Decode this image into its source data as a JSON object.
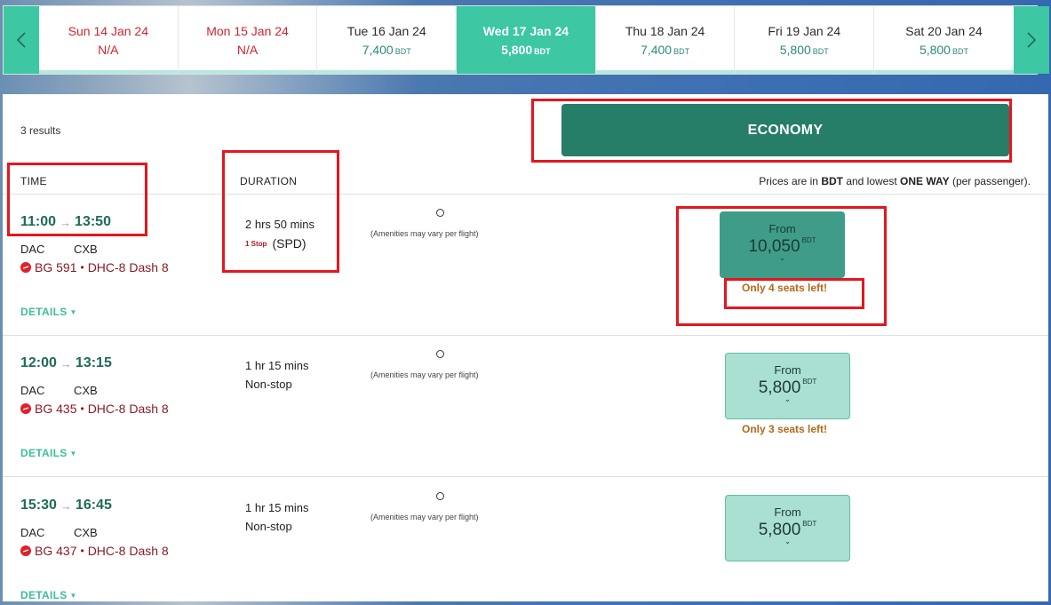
{
  "datebar": {
    "prev_icon": "chevron-left-icon",
    "next_icon": "chevron-right-icon",
    "dates": [
      {
        "label": "Sun 14 Jan 24",
        "price": "N/A",
        "currency": "",
        "status": "na"
      },
      {
        "label": "Mon 15 Jan 24",
        "price": "N/A",
        "currency": "",
        "status": "na"
      },
      {
        "label": "Tue 16 Jan 24",
        "price": "7,400",
        "currency": "BDT",
        "status": "available"
      },
      {
        "label": "Wed 17 Jan 24",
        "price": "5,800",
        "currency": "BDT",
        "status": "selected"
      },
      {
        "label": "Thu 18 Jan 24",
        "price": "7,400",
        "currency": "BDT",
        "status": "available"
      },
      {
        "label": "Fri 19 Jan 24",
        "price": "5,800",
        "currency": "BDT",
        "status": "available"
      },
      {
        "label": "Sat 20 Jan 24",
        "price": "5,800",
        "currency": "BDT",
        "status": "available"
      }
    ]
  },
  "results_count": "3 results",
  "cabin_label": "ECONOMY",
  "headers": {
    "time": "TIME",
    "duration": "DURATION",
    "price_note_prefix": "Prices are in ",
    "price_note_currency": "BDT",
    "price_note_mid": " and lowest ",
    "price_note_trip": "ONE WAY",
    "price_note_suffix": " (per passenger)."
  },
  "flights": [
    {
      "depart": "11:00",
      "arrive": "13:50",
      "origin": "DAC",
      "destination": "CXB",
      "flight_no": "BG 591",
      "aircraft": "DHC-8 Dash 8",
      "duration": "2 hrs 50 mins",
      "stops": "1 Stop",
      "via": "(SPD)",
      "amenities_note": "(Amenities may vary per flight)",
      "fare_from": "From",
      "fare_amount": "10,050",
      "fare_currency": "BDT",
      "seats_left": "Only 4 seats left!",
      "details_label": "DETAILS"
    },
    {
      "depart": "12:00",
      "arrive": "13:15",
      "origin": "DAC",
      "destination": "CXB",
      "flight_no": "BG 435",
      "aircraft": "DHC-8 Dash 8",
      "duration": "1 hr 15 mins",
      "stops": "Non-stop",
      "via": "",
      "amenities_note": "(Amenities may vary per flight)",
      "fare_from": "From",
      "fare_amount": "5,800",
      "fare_currency": "BDT",
      "seats_left": "Only 3 seats left!",
      "details_label": "DETAILS"
    },
    {
      "depart": "15:30",
      "arrive": "16:45",
      "origin": "DAC",
      "destination": "CXB",
      "flight_no": "BG 437",
      "aircraft": "DHC-8 Dash 8",
      "duration": "1 hr 15 mins",
      "stops": "Non-stop",
      "via": "",
      "amenities_note": "(Amenities may vary per flight)",
      "fare_from": "From",
      "fare_amount": "5,800",
      "fare_currency": "BDT",
      "seats_left": "",
      "details_label": "DETAILS"
    }
  ],
  "colors": {
    "accent": "#3dc7a2",
    "economy": "#267d68",
    "annotation": "#e4161e",
    "na_red": "#d4232f",
    "seat_warning": "#b5681a"
  }
}
